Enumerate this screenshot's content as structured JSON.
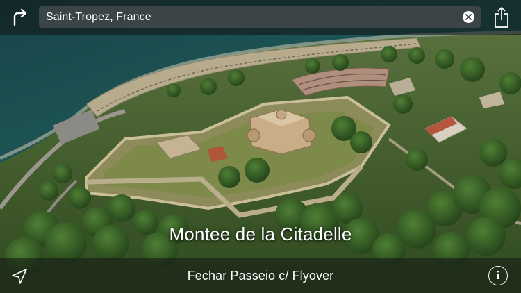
{
  "search": {
    "value": "Saint-Tropez, France"
  },
  "map": {
    "view": "Flyover 3D satellite",
    "place_label": "Montee de la Citadelle"
  },
  "bottom_bar": {
    "close_flyover_label": "Fechar Passeio c/ Flyover",
    "info_glyph": "i"
  },
  "icons": {
    "directions": "directions-icon",
    "clear": "clear-icon",
    "share": "share-icon",
    "location": "location-arrow-icon",
    "info": "info-icon"
  },
  "colors": {
    "bar_background": "#12181a",
    "search_field": "#464c4e",
    "sea": "#1d4d4d",
    "foliage": "#3f6a2a",
    "stone": "#c9b48c",
    "text": "#ffffff"
  }
}
